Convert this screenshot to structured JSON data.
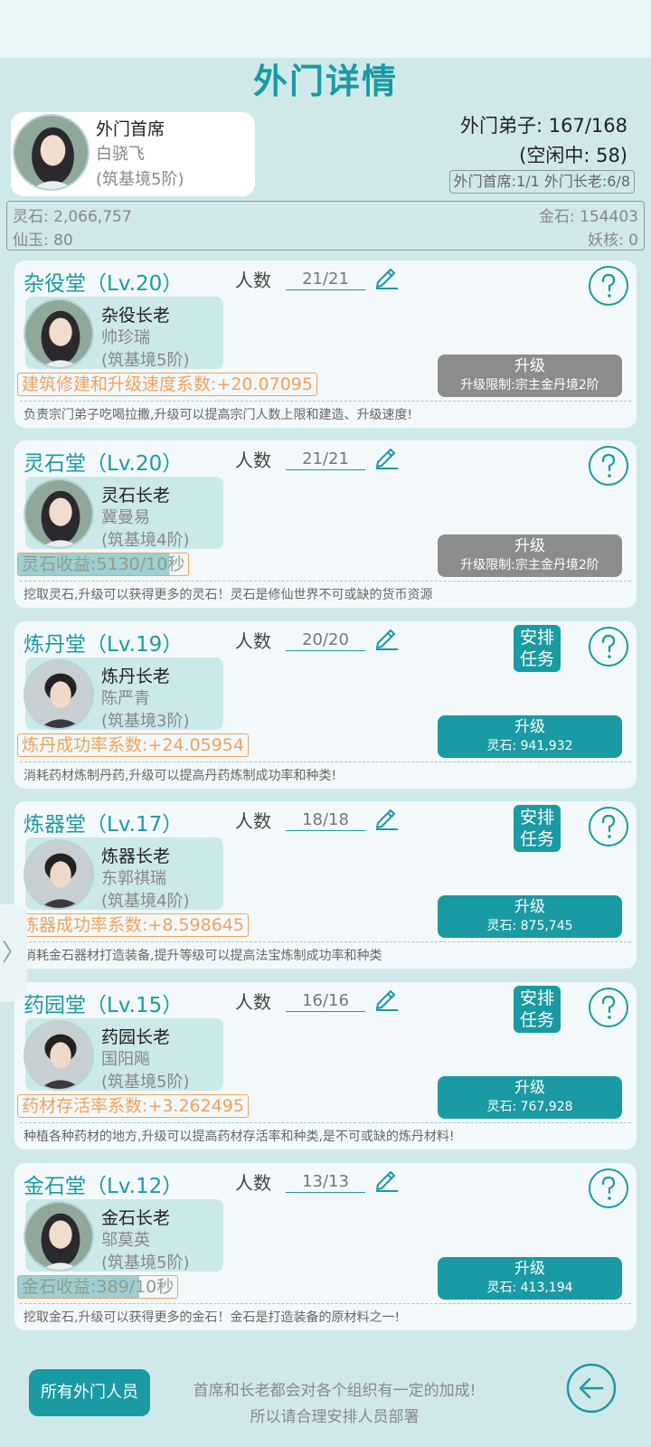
{
  "page": {
    "title": "外门详情"
  },
  "leader": {
    "title": "外门首席",
    "name": "白骁飞",
    "realm": "(筑基境5阶)"
  },
  "stats": {
    "disciples": "外门弟子: 167/168",
    "idle": "(空闲中: 58)",
    "ranks": "外门首席:1/1 外门长老:6/8"
  },
  "resources": {
    "spirit_stone": "灵石: 2,066,757",
    "gold_stone": "金石: 154403",
    "jade": "仙玉: 80",
    "demon_core": "妖核: 0"
  },
  "count_label": "人数",
  "halls": [
    {
      "name": "杂役堂（Lv.20）",
      "count": "21/21",
      "elder_title": "杂役长老",
      "elder_name": "帅珍瑞",
      "elder_realm": "(筑基境5阶)",
      "assign": "",
      "upgrade_label": "升级",
      "upgrade_sub": "升级限制:宗主金丹境2阶",
      "bonus": "建筑修建和升级速度系数:+20.07095",
      "bonus_bg_fraction": 0,
      "desc": "负责宗门弟子吃喝拉撒,升级可以提高宗门人数上限和建造、升级速度!"
    },
    {
      "name": "灵石堂（Lv.20）",
      "count": "21/21",
      "elder_title": "灵石长老",
      "elder_name": "冀曼易",
      "elder_realm": "(筑基境4阶)",
      "assign": "",
      "upgrade_label": "升级",
      "upgrade_sub": "升级限制:宗主金丹境2阶",
      "bonus": "灵石收益:5130/10秒",
      "bonus_bg_fraction": 0.89,
      "desc": "挖取灵石,升级可以获得更多的灵石！灵石是修仙世界不可或缺的货币资源"
    },
    {
      "name": "炼丹堂（Lv.19）",
      "count": "20/20",
      "elder_title": "炼丹长老",
      "elder_name": "陈严青",
      "elder_realm": "(筑基境3阶)",
      "assign": "安排任务",
      "upgrade_label": "升级",
      "upgrade_sub": "灵石: 941,932",
      "bonus": "炼丹成功率系数:+24.05954",
      "bonus_bg_fraction": 0,
      "desc": "消耗药材炼制丹药,升级可以提高丹药炼制成功率和种类!"
    },
    {
      "name": "炼器堂（Lv.17）",
      "count": "18/18",
      "elder_title": "炼器长老",
      "elder_name": "东郭祺瑞",
      "elder_realm": "(筑基境4阶)",
      "assign": "安排任务",
      "upgrade_label": "升级",
      "upgrade_sub": "灵石: 875,745",
      "bonus": "炼器成功率系数:+8.598645",
      "bonus_bg_fraction": 0,
      "desc": "消耗金石器材打造装备,提升等级可以提高法宝炼制成功率和种类"
    },
    {
      "name": "药园堂（Lv.15）",
      "count": "16/16",
      "elder_title": "药园长老",
      "elder_name": "国阳飚",
      "elder_realm": "(筑基境5阶)",
      "assign": "安排任务",
      "upgrade_label": "升级",
      "upgrade_sub": "灵石: 767,928",
      "bonus": "药材存活率系数:+3.262495",
      "bonus_bg_fraction": 0,
      "desc": "种植各种药材的地方,升级可以提高药材存活率和种类,是不可或缺的炼丹材料!"
    },
    {
      "name": "金石堂（Lv.12）",
      "count": "13/13",
      "elder_title": "金石长老",
      "elder_name": "邬莫英",
      "elder_realm": "(筑基境5阶)",
      "assign": "",
      "upgrade_label": "升级",
      "upgrade_sub": "灵石: 413,194",
      "bonus": "金石收益:389/10秒",
      "bonus_bg_fraction": 0.76,
      "desc": "挖取金石,升级可以获得更多的金石！金石是打造装备的原材料之一!"
    }
  ],
  "footer": {
    "all_button": "所有外门人员",
    "tip1": "首席和长老都会对各个组织有一定的加成!",
    "tip2": "所以请合理安排人员部署"
  },
  "side_tab": "〉",
  "colors": {
    "accent": "#1a9aa3",
    "bonus": "#f2a25c",
    "disabled": "#8c8c8c",
    "background": "#cfe9ea"
  }
}
